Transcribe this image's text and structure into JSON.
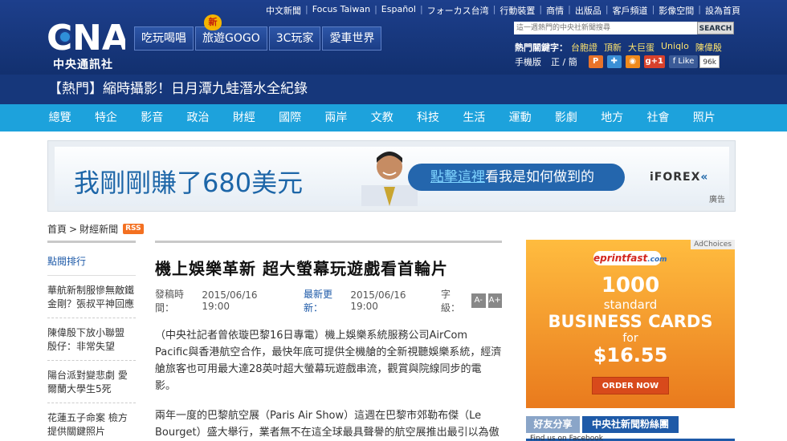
{
  "header": {
    "logo_text": "中央通訊社",
    "top_links": [
      "中文新聞",
      "Focus Taiwan",
      "Español",
      "フォーカス台湾",
      "行動裝置",
      "商情",
      "出版品",
      "客戶頻道",
      "影像空間",
      "設為首頁"
    ],
    "channels": [
      {
        "label": "吃玩喝唱"
      },
      {
        "label": "旅遊GOGO"
      },
      {
        "label": "3C玩家"
      },
      {
        "label": "愛車世界"
      }
    ],
    "new_badge": "新",
    "search": {
      "placeholder": "這一週熱門的中央社新聞搜尋",
      "button": "SEARCH"
    },
    "hot_keywords_label": "熱門關鍵字：",
    "hot_keywords": [
      "台胞證",
      "頂新",
      "大巨蛋",
      "Uniqlo",
      "陳偉殷"
    ],
    "mobile_label": "手機版",
    "lang_switch": "正 / 簡",
    "like_label": "Like",
    "like_count": "96k"
  },
  "hot_bar": {
    "text": "【熱門】縮時攝影！日月潭九蛙潛水全紀錄"
  },
  "categories": [
    "總覽",
    "特企",
    "影音",
    "政治",
    "財經",
    "國際",
    "兩岸",
    "文教",
    "科技",
    "生活",
    "運動",
    "影劇",
    "地方",
    "社會",
    "照片"
  ],
  "top_ad": {
    "headline": "我剛剛賺了680美元",
    "cta_prefix": "點擊這裡",
    "cta_rest": "看我是如何做到的",
    "brand": "iFOREX",
    "tag": "廣告"
  },
  "breadcrumb": {
    "home": "首頁",
    "sep": ">",
    "section": "財經新聞",
    "rss": "RSS"
  },
  "sidebar": {
    "title": "點閱排行",
    "items": [
      "華航新制服慘無敵鐵金剛？張叔平神回應",
      "陳偉殷下放小聯盟 殷仔：非常失望",
      "陽台派對變悲劇 愛爾蘭大學生5死",
      "花蓮五子命案 檢方提供關鍵照片"
    ]
  },
  "article": {
    "title": "機上娛樂革新 超大螢幕玩遊戲看首輪片",
    "published_label": "發稿時間：",
    "published": "2015/06/16 19:00",
    "updated_label": "最新更新：",
    "updated": "2015/06/16 19:00",
    "font_size_label": "字級：",
    "font_minus": "A-",
    "font_plus": "A+",
    "paragraphs": [
      "（中央社記者曾依璇巴黎16日專電）機上娛樂系統服務公司AirCom Pacific與香港航空合作，最快年底可提供全機艙的全新視聽娛樂系統，經濟艙旅客也可用最大達28英吋超大螢幕玩遊戲串流，觀賞與院線同步的電影。",
      "兩年一度的巴黎航空展（Paris Air Show）這週在巴黎市郊勒布傑（Le Bourget）盛大舉行，業者無不在這全球最具聲譽的航空展推出最引以為傲的產品和技術。"
    ]
  },
  "right_ad": {
    "adchoices": "AdChoices",
    "brand": "eprintfast",
    "brand_suffix": ".com",
    "number": "1000",
    "standard": "standard",
    "product": "BUSINESS CARDS",
    "for": "for",
    "price": "$16.55",
    "order": "ORDER NOW"
  },
  "fb_tabs": {
    "share": "好友分享",
    "fans": "中央社新聞粉絲團",
    "caption": "Find us on Facebook"
  },
  "colors": {
    "header_blue": "#1d3f8c",
    "nav_cyan": "#1da2dc",
    "link_blue": "#1e5aa8",
    "rss_orange": "#f37021",
    "ad_orange": "#e97a1d"
  }
}
